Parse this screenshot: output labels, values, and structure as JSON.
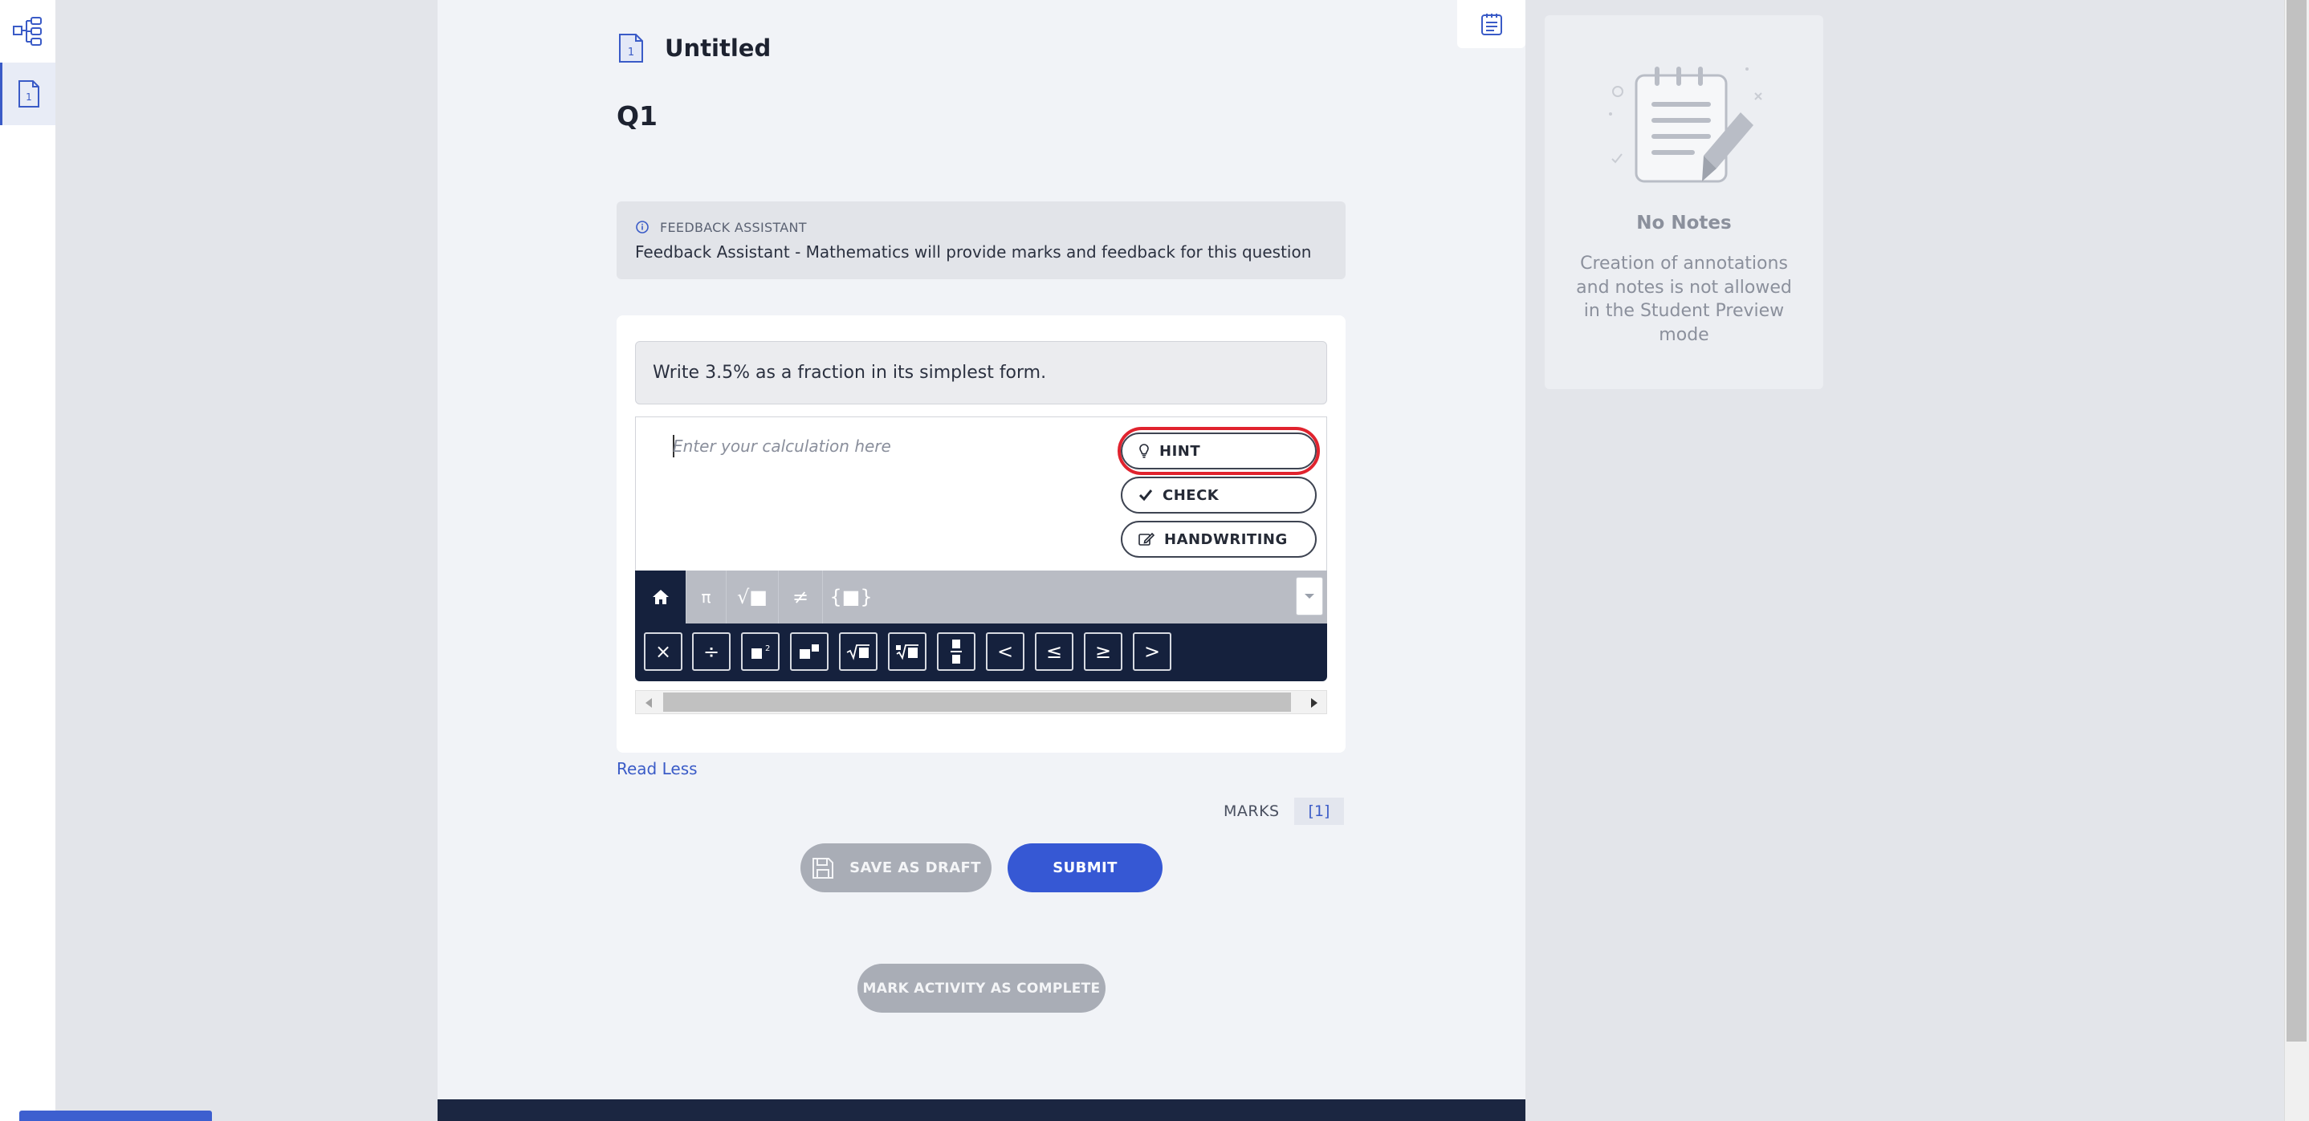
{
  "rail": {
    "items": [
      {
        "icon": "tree-structure-icon"
      },
      {
        "icon": "page-one-icon",
        "number": "1"
      }
    ]
  },
  "header": {
    "title": "Untitled",
    "page_icon_number": "1"
  },
  "question": {
    "label": "Q1",
    "assistant_heading": "FEEDBACK ASSISTANT",
    "assistant_text": "Feedback Assistant - Mathematics will provide marks and feedback for this question",
    "prompt": "Write 3.5% as a fraction in its simplest form.",
    "input_placeholder": "Enter your calculation here",
    "input_value": ""
  },
  "answer_options": {
    "hint": "HINT",
    "check": "CHECK",
    "handwriting": "HANDWRITING"
  },
  "math_keyboard": {
    "tabs": [
      "home",
      "π",
      "√■",
      "≠",
      "{■}"
    ],
    "keys": [
      "×",
      "÷",
      "■²",
      "■■",
      "√■",
      "∜■",
      "■/■",
      "<",
      "≤",
      "≥",
      ">"
    ]
  },
  "read_less": "Read Less",
  "marks": {
    "label": "MARKS",
    "value": "[1]"
  },
  "actions": {
    "save_draft": "SAVE AS DRAFT",
    "submit": "SUBMIT",
    "mark_complete": "MARK ACTIVITY AS COMPLETE"
  },
  "notes": {
    "title": "No Notes",
    "message": "Creation of annotations and notes is not allowed in the Student Preview mode"
  },
  "colors": {
    "accent": "#3658d4",
    "link": "#3a5bc7",
    "dark_navy": "#15213d",
    "hint_highlight": "#e0232e"
  }
}
